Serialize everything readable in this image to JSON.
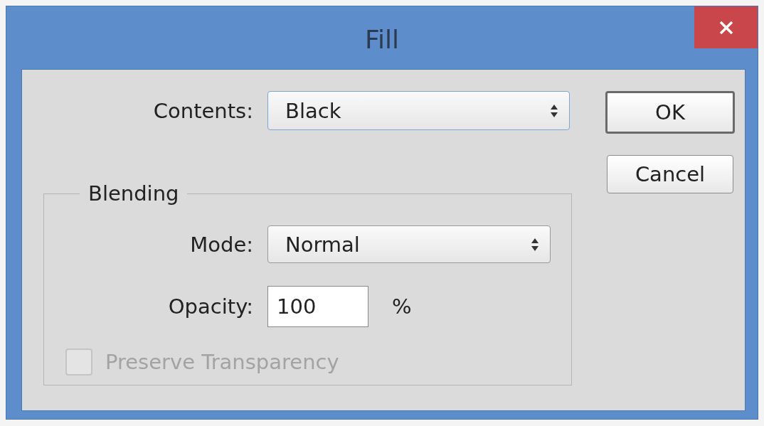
{
  "window": {
    "title": "Fill"
  },
  "contents": {
    "label": "Contents:",
    "value": "Black"
  },
  "blending": {
    "legend": "Blending",
    "mode": {
      "label": "Mode:",
      "value": "Normal"
    },
    "opacity": {
      "label": "Opacity:",
      "value": "100",
      "unit": "%"
    },
    "preserve_transparency": {
      "label": "Preserve Transparency",
      "checked": false,
      "disabled": true
    }
  },
  "buttons": [
    {
      "label": "OK",
      "default": true
    },
    {
      "label": "Cancel",
      "default": false
    }
  ]
}
